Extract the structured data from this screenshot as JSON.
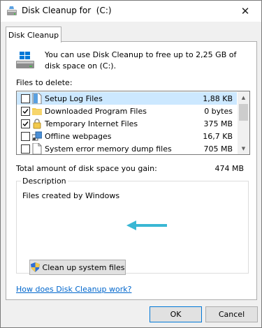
{
  "window": {
    "title": "Disk Cleanup for  (C:)",
    "close_glyph": "✕"
  },
  "tabs": [
    {
      "label": "Disk Cleanup",
      "active": true
    }
  ],
  "intro": {
    "text": "You can use Disk Cleanup to free up to 2,25 GB of disk space on  (C:)."
  },
  "files": {
    "label": "Files to delete:",
    "items": [
      {
        "name": "Setup Log Files",
        "size": "1,88 KB",
        "checked": false,
        "selected": true,
        "icon": "file-icon"
      },
      {
        "name": "Downloaded Program Files",
        "size": "0 bytes",
        "checked": true,
        "selected": false,
        "icon": "folder-icon"
      },
      {
        "name": "Temporary Internet Files",
        "size": "375 MB",
        "checked": true,
        "selected": false,
        "icon": "lock-icon"
      },
      {
        "name": "Offline webpages",
        "size": "16,7 KB",
        "checked": false,
        "selected": false,
        "icon": "offline-pages-icon"
      },
      {
        "name": "System error memory dump files",
        "size": "705 MB",
        "checked": false,
        "selected": false,
        "icon": "file-icon"
      }
    ]
  },
  "total": {
    "label": "Total amount of disk space you gain:",
    "value": "474 MB"
  },
  "description": {
    "legend": "Description",
    "text": "Files created by Windows"
  },
  "buttons": {
    "cleanup_system": "Clean up system files",
    "ok": "OK",
    "cancel": "Cancel"
  },
  "help_link": "How does Disk Cleanup work?",
  "colors": {
    "accent": "#0078d7",
    "selection": "#cce8ff",
    "link": "#0066cc",
    "arrow": "#3ab7d4"
  }
}
